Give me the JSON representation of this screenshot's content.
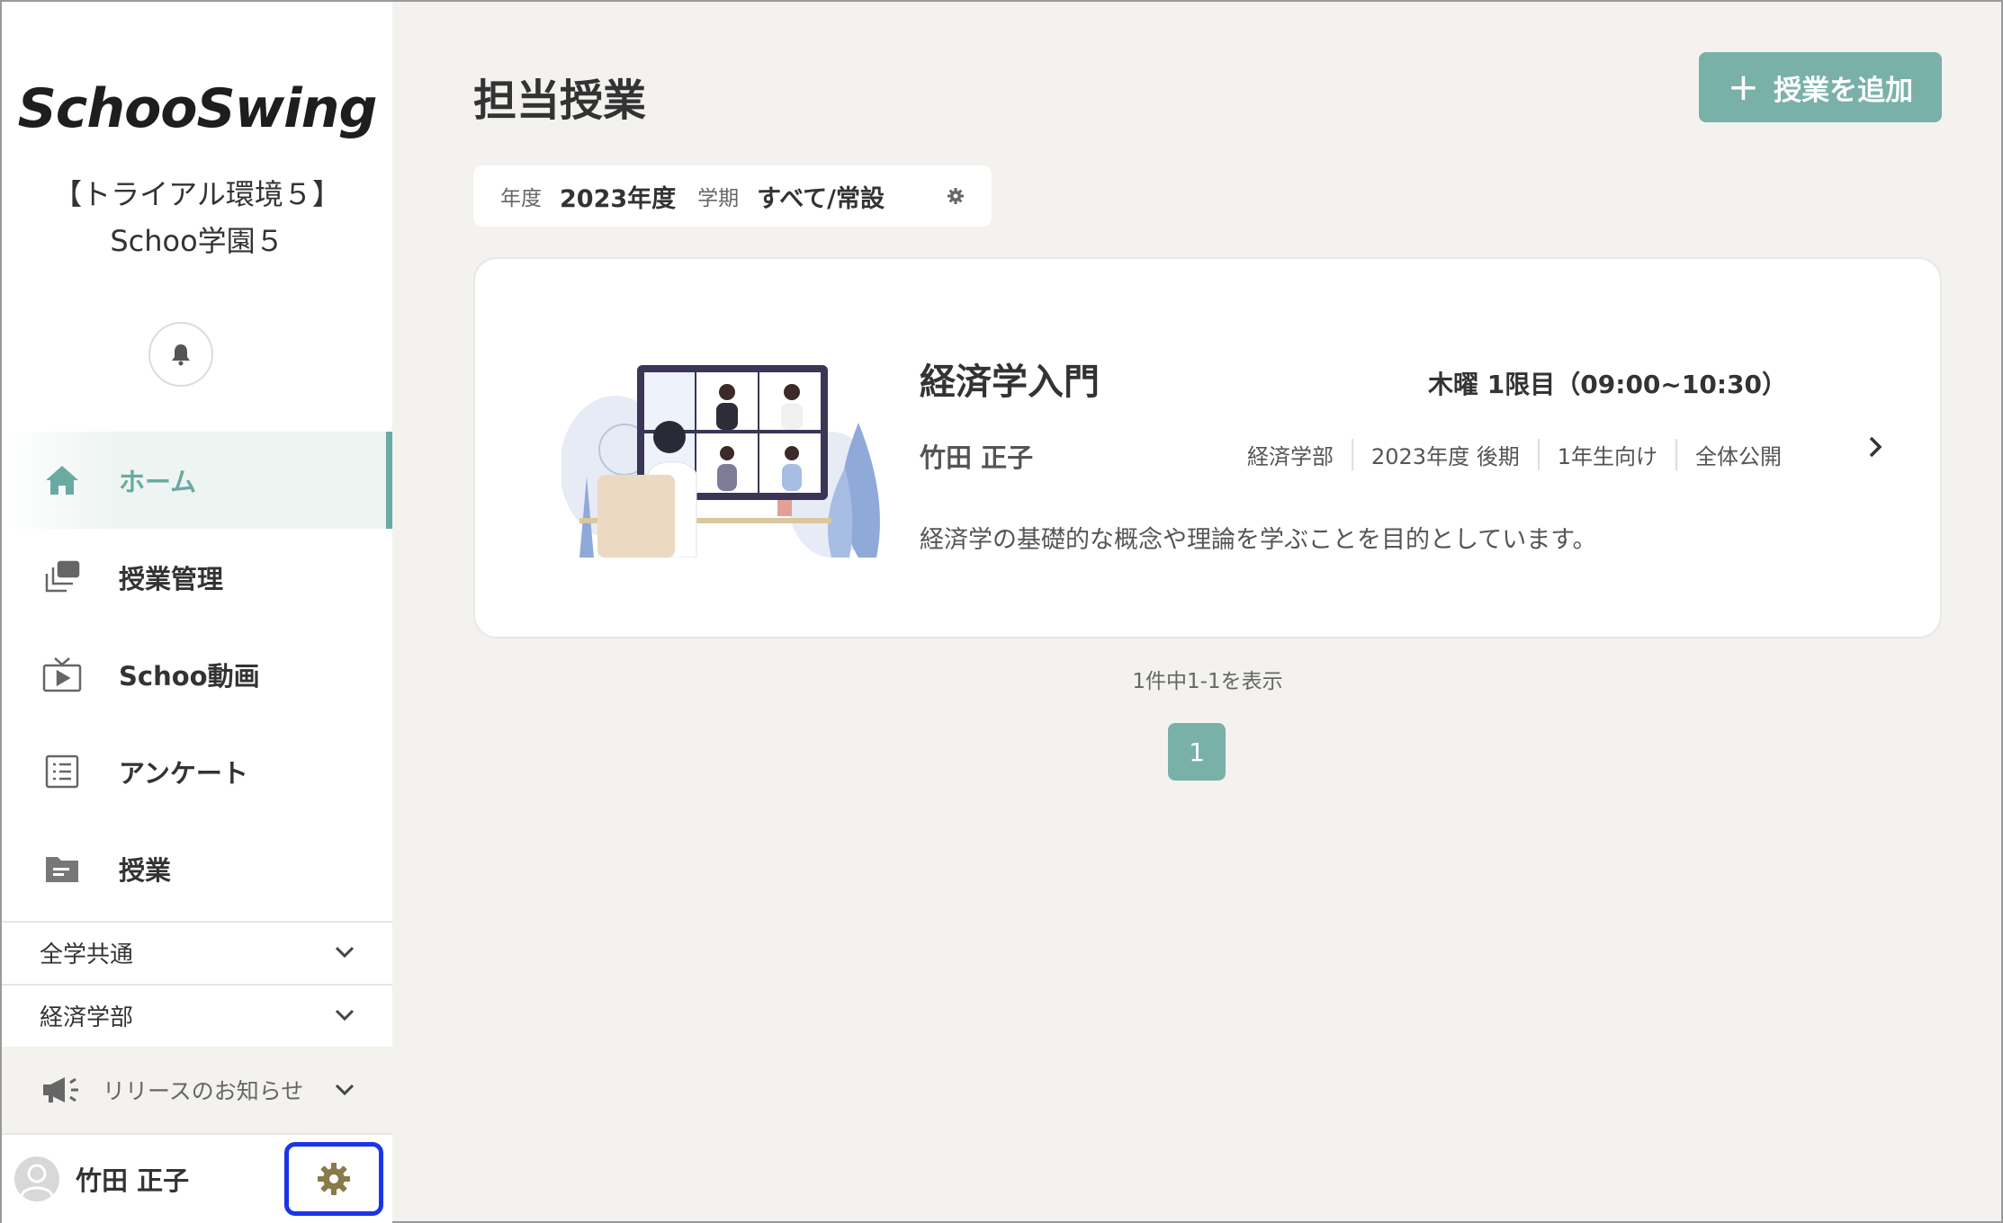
{
  "sidebar": {
    "logo": "SchooSwing",
    "org_name": "【トライアル環境５】Schoo学園５",
    "nav": [
      {
        "label": "ホーム",
        "icon": "home-icon",
        "active": true
      },
      {
        "label": "授業管理",
        "icon": "stack-icon",
        "active": false
      },
      {
        "label": "Schoo動画",
        "icon": "video-icon",
        "active": false
      },
      {
        "label": "アンケート",
        "icon": "list-icon",
        "active": false
      },
      {
        "label": "授業",
        "icon": "folder-icon",
        "active": false
      }
    ],
    "sections": [
      {
        "label": "全学共通"
      },
      {
        "label": "経済学部"
      }
    ],
    "release": {
      "label": "リリースのお知らせ"
    },
    "user": {
      "name": "竹田 正子"
    }
  },
  "main": {
    "title": "担当授業",
    "add_button": "授業を追加",
    "filter": {
      "year_key": "年度",
      "year_value": "2023年度",
      "term_key": "学期",
      "term_value": "すべて/常設"
    },
    "course": {
      "title": "経済学入門",
      "schedule": "木曜 1限目（09:00~10:30）",
      "teacher": "竹田 正子",
      "tags": [
        "経済学部",
        "2023年度 後期",
        "1年生向け",
        "全体公開"
      ],
      "description": "経済学の基礎的な概念や理論を学ぶことを目的としています。"
    },
    "count_text": "1件中1-1を表示",
    "pagination": {
      "current": "1"
    }
  },
  "colors": {
    "accent": "#79b1a9",
    "active_nav": "#6aaaa2",
    "gear": "#8a7a4a",
    "highlight_border": "#1a35e8"
  }
}
